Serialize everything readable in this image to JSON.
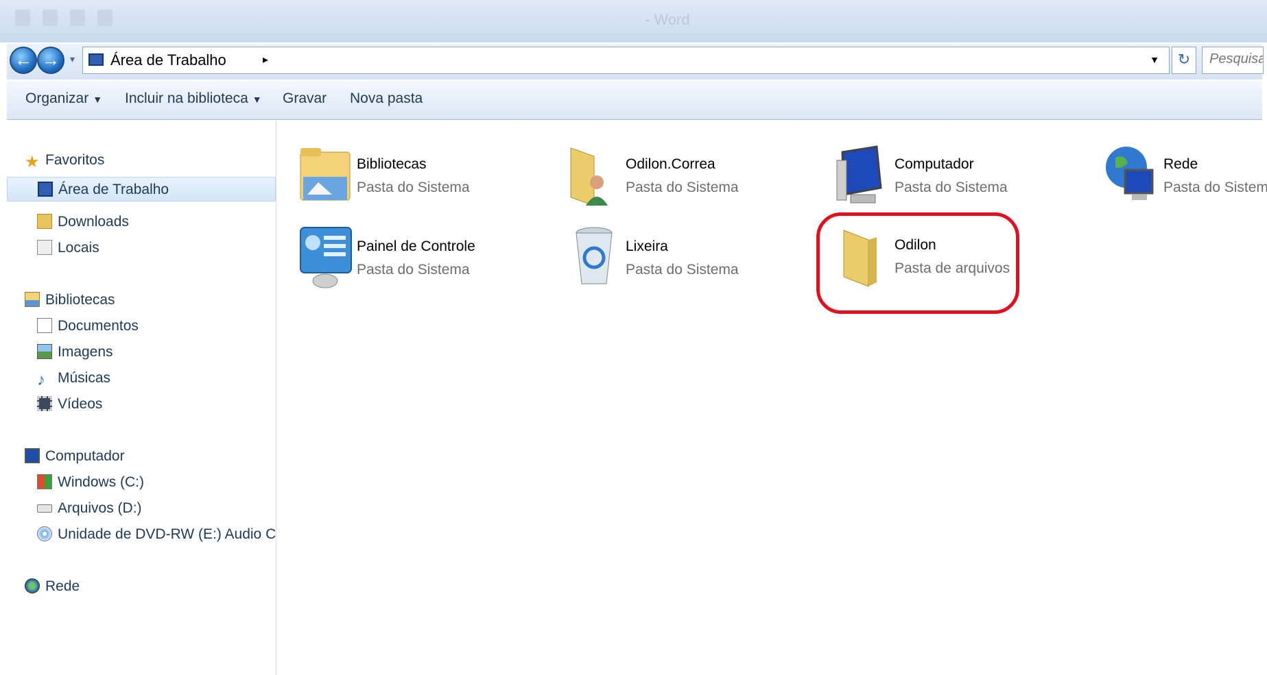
{
  "window": {
    "ghost_title": "- Word"
  },
  "address": {
    "location": "Área de Trabalho",
    "search_placeholder": "Pesquisar..."
  },
  "toolbar": {
    "organize": "Organizar",
    "include_library": "Incluir na biblioteca",
    "burn": "Gravar",
    "new_folder": "Nova pasta"
  },
  "sidebar": {
    "favorites": "Favoritos",
    "desktop": "Área de Trabalho",
    "downloads": "Downloads",
    "places": "Locais",
    "libraries": "Bibliotecas",
    "documents": "Documentos",
    "images": "Imagens",
    "music": "Músicas",
    "videos": "Vídeos",
    "computer": "Computador",
    "drive_c": "Windows (C:)",
    "drive_d": "Arquivos (D:)",
    "drive_e": "Unidade de DVD-RW (E:) Audio CD",
    "network": "Rede"
  },
  "items": [
    {
      "name": "Bibliotecas",
      "desc": "Pasta do Sistema"
    },
    {
      "name": "Odilon.Correa",
      "desc": "Pasta do Sistema"
    },
    {
      "name": "Computador",
      "desc": "Pasta do Sistema"
    },
    {
      "name": "Rede",
      "desc": "Pasta do Sistema"
    },
    {
      "name": "Painel de Controle",
      "desc": "Pasta do Sistema"
    },
    {
      "name": "Lixeira",
      "desc": "Pasta do Sistema"
    },
    {
      "name": "Odilon",
      "desc": "Pasta de arquivos"
    }
  ],
  "colors": {
    "highlight": "#e2101d",
    "selection": "#d3e6fa"
  }
}
